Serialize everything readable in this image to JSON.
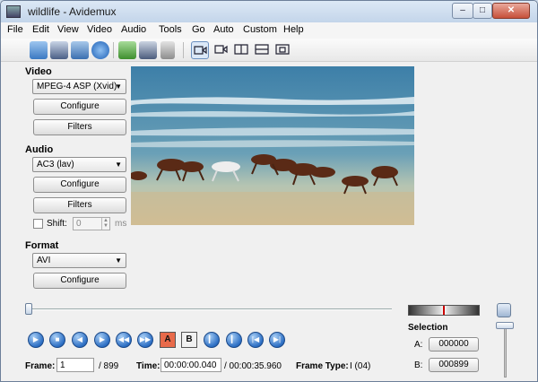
{
  "window": {
    "title": "wildlife - Avidemux"
  },
  "menu": [
    "File",
    "Edit",
    "View",
    "Video",
    "Audio",
    "Tools",
    "Go",
    "Auto",
    "Custom",
    "Help"
  ],
  "toolbar": {
    "icons": [
      "open-icon",
      "save-icon",
      "save-as-icon",
      "info-icon",
      "open-folder-icon",
      "save-video-icon",
      "calculator-icon",
      "view-input-icon",
      "view-output-icon",
      "view-side-by-side-icon",
      "view-top-bottom-icon",
      "view-separate-icon"
    ]
  },
  "video": {
    "label": "Video",
    "codec": "MPEG-4 ASP (Xvid)",
    "configure": "Configure",
    "filters": "Filters"
  },
  "audio": {
    "label": "Audio",
    "codec": "AC3 (lav)",
    "configure": "Configure",
    "filters": "Filters",
    "shift_label": "Shift:",
    "shift_value": "0",
    "shift_unit": "ms"
  },
  "format": {
    "label": "Format",
    "container": "AVI",
    "configure": "Configure"
  },
  "status": {
    "frame_label": "Frame:",
    "frame_value": "1",
    "frame_total": "/ 899",
    "time_label": "Time:",
    "time_value": "00:00:00.040",
    "time_total": "/ 00:00:35.960",
    "frame_type_label": "Frame Type:",
    "frame_type_value": "I (04)"
  },
  "selection": {
    "label": "Selection",
    "a_label": "A:",
    "a_value": "000000",
    "b_label": "B:",
    "b_value": "000899"
  },
  "playback": {
    "marker_a": "A",
    "marker_b": "B"
  },
  "colors": {
    "accent": "#2d6fc4",
    "titlebar": "#c3d5ea"
  }
}
